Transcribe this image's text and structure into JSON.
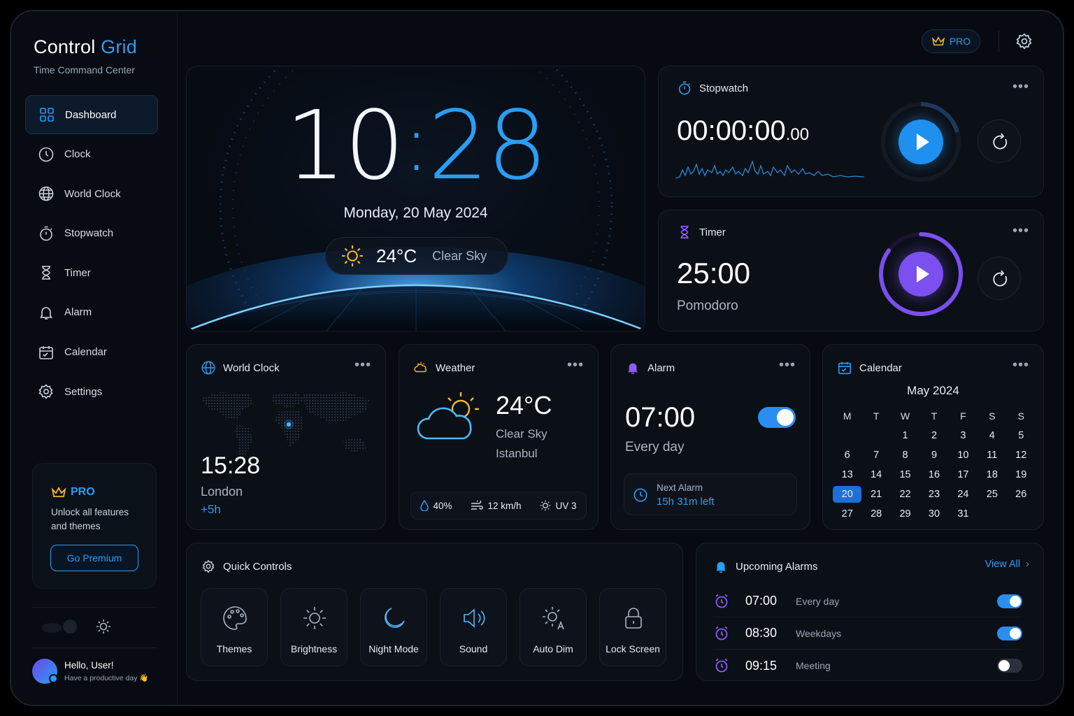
{
  "app": {
    "title_main": "Control ",
    "title_accent": "Grid",
    "subtitle": "Time Command Center"
  },
  "sidebar": {
    "items": [
      {
        "label": "Dashboard",
        "icon": "dashboard-icon"
      },
      {
        "label": "Clock",
        "icon": "clock-icon"
      },
      {
        "label": "World Clock",
        "icon": "globe-icon"
      },
      {
        "label": "Stopwatch",
        "icon": "stopwatch-icon"
      },
      {
        "label": "Timer",
        "icon": "hourglass-icon"
      },
      {
        "label": "Alarm",
        "icon": "bell-icon"
      },
      {
        "label": "Calendar",
        "icon": "calendar-icon"
      },
      {
        "label": "Settings",
        "icon": "gear-icon"
      }
    ],
    "promo": {
      "title": "PRO",
      "desc": "Unlock all features and themes",
      "button": "Go Premium"
    },
    "user": {
      "greeting": "Hello, User!",
      "tagline": "Have a productive day 👋"
    }
  },
  "header": {
    "pro_label": "PRO"
  },
  "clock": {
    "hours": "10",
    "colon": ":",
    "minutes": "28",
    "date": "Monday, 20 May 2024",
    "temp": "24°C",
    "condition": "Clear Sky"
  },
  "stopwatch": {
    "title": "Stopwatch",
    "time_main": "00:00:00",
    "time_frac": ".00"
  },
  "timer": {
    "title": "Timer",
    "time": "25:00",
    "mode": "Pomodoro",
    "progress": 0.85
  },
  "world_clock": {
    "title": "World Clock",
    "time": "15:28",
    "city": "London",
    "offset": "+5h"
  },
  "weather": {
    "title": "Weather",
    "temp": "24°C",
    "condition": "Clear Sky",
    "city": "Istanbul",
    "humidity": "40%",
    "wind": "12 km/h",
    "uv": "UV 3"
  },
  "alarm": {
    "title": "Alarm",
    "time": "07:00",
    "repeat": "Every day",
    "enabled": true,
    "next_label": "Next Alarm",
    "next_value": "15h 31m left"
  },
  "calendar": {
    "title": "Calendar",
    "month": "May 2024",
    "weekdays": [
      "M",
      "T",
      "W",
      "T",
      "F",
      "S",
      "S"
    ],
    "weeks": [
      [
        "",
        "",
        "1",
        "2",
        "3",
        "4",
        "5"
      ],
      [
        "6",
        "7",
        "8",
        "9",
        "10",
        "11",
        "12"
      ],
      [
        "13",
        "14",
        "15",
        "16",
        "17",
        "18",
        "19"
      ],
      [
        "20",
        "21",
        "22",
        "23",
        "24",
        "25",
        "26"
      ],
      [
        "27",
        "28",
        "29",
        "30",
        "31",
        "",
        ""
      ]
    ],
    "today": "20"
  },
  "quick_controls": {
    "title": "Quick Controls",
    "items": [
      {
        "label": "Themes",
        "icon": "palette-icon"
      },
      {
        "label": "Brightness",
        "icon": "sun-icon"
      },
      {
        "label": "Night Mode",
        "icon": "moon-icon"
      },
      {
        "label": "Sound",
        "icon": "speaker-icon"
      },
      {
        "label": "Auto Dim",
        "icon": "auto-dim-icon"
      },
      {
        "label": "Lock Screen",
        "icon": "lock-icon"
      }
    ]
  },
  "upcoming": {
    "title": "Upcoming Alarms",
    "view_all": "View All",
    "alarms": [
      {
        "time": "07:00",
        "label": "Every day",
        "enabled": true
      },
      {
        "time": "08:30",
        "label": "Weekdays",
        "enabled": true
      },
      {
        "time": "09:15",
        "label": "Meeting",
        "enabled": false
      }
    ]
  },
  "colors": {
    "accent": "#2a9df4",
    "purple": "#7b4ff0",
    "background": "#070a10",
    "gold": "#f5b62a"
  }
}
